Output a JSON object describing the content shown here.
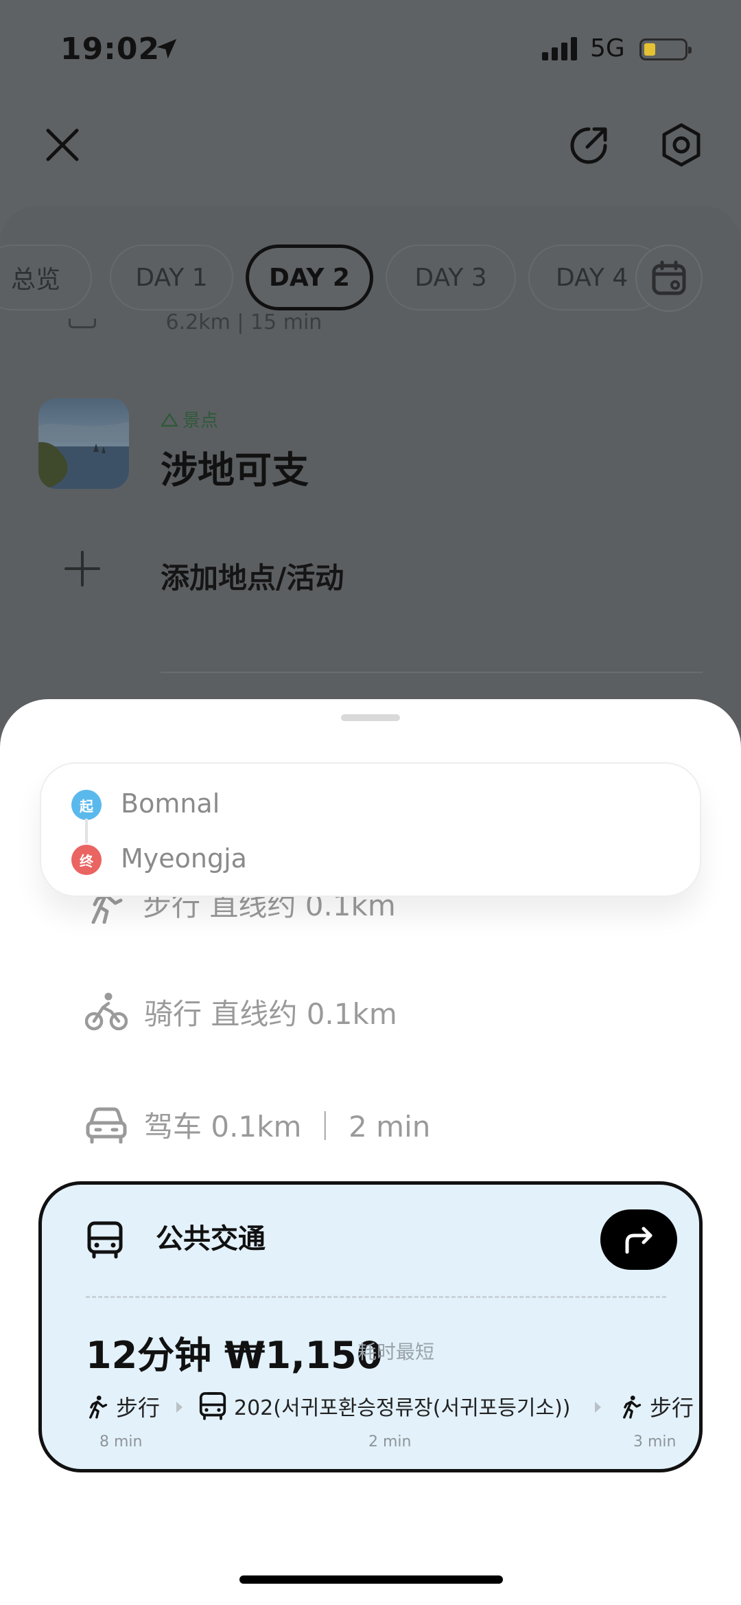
{
  "status_bar": {
    "time": "19:02",
    "network": "5G"
  },
  "tabs": [
    {
      "label": "总览"
    },
    {
      "label": "DAY 1"
    },
    {
      "label": "DAY 2",
      "active": true
    },
    {
      "label": "DAY 3"
    },
    {
      "label": "DAY 4"
    }
  ],
  "itinerary": {
    "peek_row": "6.2km | 15 min",
    "place": {
      "tag": "景点",
      "name": "涉地可支"
    },
    "add_label": "添加地点/活动"
  },
  "route": {
    "start_badge": "起",
    "start": "Bomnal",
    "end_badge": "终",
    "end": "Myeongja"
  },
  "modes": {
    "walk": "步行 直线约 0.1km",
    "bike": "骑行 直线约 0.1km",
    "drive": "驾车 0.1km ｜ 2 min"
  },
  "transit": {
    "title": "公共交通",
    "summary": "12分钟 ₩1,150",
    "fastest": "耗时最短",
    "segments": [
      {
        "label": "步行",
        "duration": "8 min"
      },
      {
        "label": "202(서귀포환승정류장(서귀포등기소))",
        "duration": "2 min"
      },
      {
        "label": "步行",
        "duration": "3 min"
      }
    ]
  },
  "colors": {
    "start_badge": "#5ab9ec",
    "end_badge": "#ea6461",
    "transit_card_bg": "#e3f1fa",
    "battery": "#e5c234"
  }
}
